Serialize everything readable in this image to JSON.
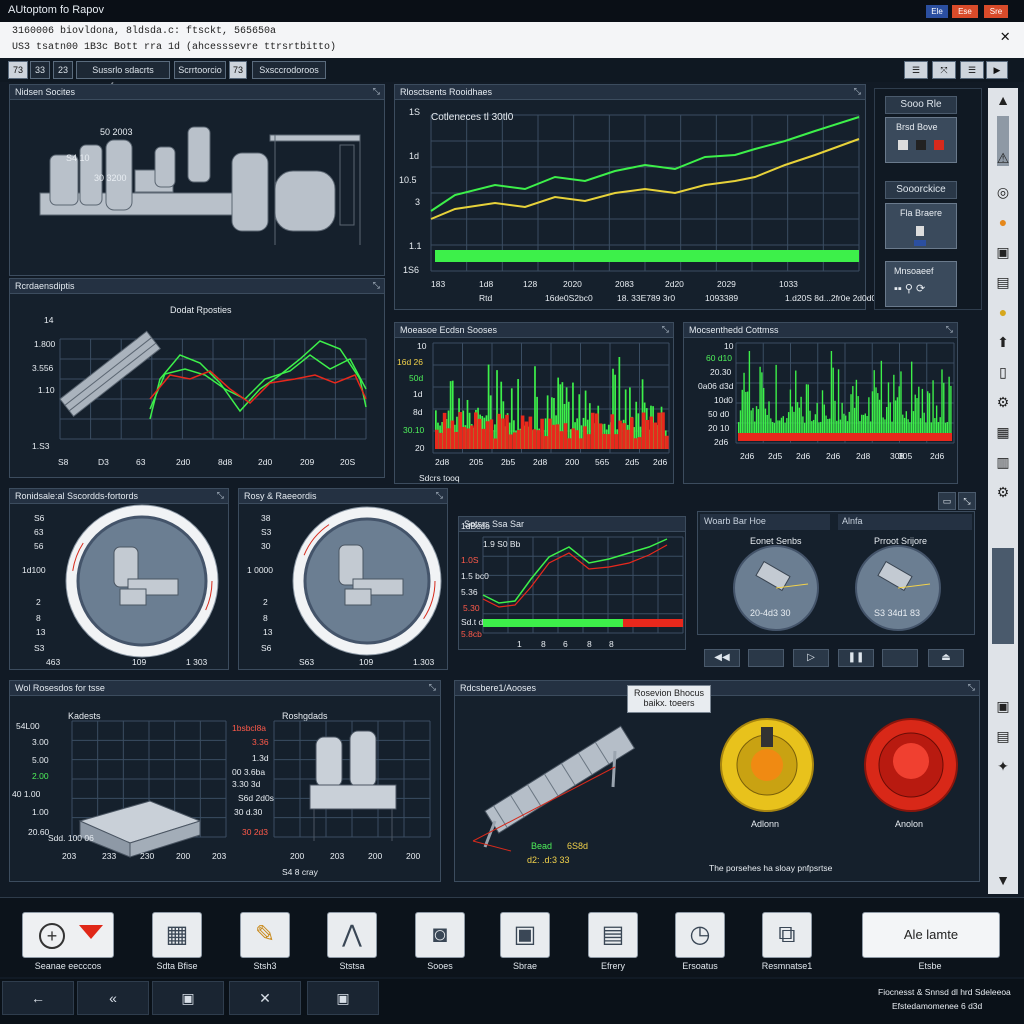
{
  "window": {
    "title": "AUtoptom fo Rapov",
    "btn1": "Ele",
    "btn2": "Ese",
    "btn3": "Sre"
  },
  "infobar": {
    "line1": "3160006 biovldona, 8ldsda.c: ftsckt, 565650a",
    "line2": "US3  tsatn00 1B3c   Bott rra   1d  (ahcesssevre  ttrsrtbitto)"
  },
  "toolbar": {
    "b1": "73",
    "b2": "33",
    "b3": "23",
    "b4": "Sussrlo sdacrts rferrocs",
    "b5": "Scrrtoorcio",
    "b6": "73",
    "b7": "Sxsccrodoroos"
  },
  "panels": {
    "machine_top": {
      "title": "Nidsen Socites",
      "labels": [
        "50 2003",
        "S4 10",
        "30 3200"
      ]
    },
    "trend_top": {
      "title": "Rlosctsents Rooidhaes",
      "series_label": "Cotleneces tl 30tl0",
      "ylabels": [
        "1S",
        "1d",
        "10.5",
        "3",
        "1.1",
        "1S6"
      ],
      "xlabels": [
        "183",
        "1d8",
        "128",
        "2020",
        "2083",
        "2d20",
        "2029",
        "1033"
      ],
      "xsub": [
        "Rtd",
        "16de0S2bc0",
        "18. 33E789 3r0",
        "1093389",
        "1.d20S 8d...2fr0e 2d0d0"
      ]
    },
    "conveyor_chart": {
      "title": "Rcrdaensdiptis",
      "subtitle": "Dodat Rposties",
      "ylabels": [
        "14",
        "1.800",
        "3.556",
        "1.10",
        "1.S3"
      ],
      "xlabels": [
        "S8",
        "D3",
        "63",
        "2d0",
        "8d8",
        "2d0",
        "209",
        "20S"
      ]
    },
    "bars_mid": {
      "title": "Moeasoe Ecdsn Sooses",
      "ylabels": [
        "10",
        "16d 26",
        "50d",
        "1d",
        "8d",
        "30.10",
        "20"
      ],
      "xlabels": [
        "2d8",
        "205",
        "2b5",
        "2d8",
        "200",
        "565",
        "2d5",
        "2d6"
      ],
      "foot": "Sdcrs tooq"
    },
    "bars_right": {
      "title": "Mocsenthedd Cottmss",
      "ylabels": [
        "10",
        "60 d10",
        "20.30",
        "0a06 d3d",
        "10d0",
        "50 d0",
        "20 10",
        "2d6"
      ],
      "xlabels": [
        "2d6",
        "2d5",
        "2d6",
        "2d6",
        "2d8",
        "308",
        "305",
        "2d6"
      ]
    },
    "gauge_left": {
      "title": "Ronidsale:al Sscordds-fortords",
      "ylabels": [
        "S6",
        "63",
        "56",
        "1d100",
        "2",
        "8",
        "13",
        "S3"
      ],
      "xlabels": [
        "463",
        "109",
        "1 303"
      ]
    },
    "gauge_right": {
      "title": "Rosy & Raeeordis",
      "ylabels": [
        "38",
        "S3",
        "30",
        "1 0000",
        "2",
        "8",
        "13",
        "S6"
      ],
      "xlabels": [
        "S63",
        "109",
        "1.303"
      ]
    },
    "mini_trend": {
      "title": "Sotsrs Ssa Sar",
      "ylabels": [
        "1dBcdo",
        "1.9 S0 Bb",
        "1.0S",
        "1.5 bc0",
        "5.36",
        "5.30",
        "Sd.t d",
        "5.8cb"
      ],
      "xlabels": [
        "1",
        "8",
        "6",
        "8",
        "8"
      ]
    },
    "sensors": {
      "title1": "Woarb Bar Hoe",
      "title2": "Alnfa",
      "sub1": "Eonet Senbs",
      "sub2": "Prroot Srijore",
      "val1": "20-4d3 30",
      "val2": "S3 34d1 83"
    },
    "inventory": {
      "title": "Wol Rosesdos for tsse",
      "sub1": "Kadests",
      "sub2": "Roshgdads",
      "ylabels": [
        "54L00",
        "3.00",
        "5.00",
        "2.00",
        "40 1.00",
        "1.00",
        "20.60"
      ],
      "xlabels": [
        "203",
        "233",
        "230",
        "200",
        "203",
        "200",
        "203",
        "200",
        "200"
      ],
      "mid_ylabels": [
        "1bsbcl8a",
        "3.36",
        "1.3d",
        "00 3.6ba",
        "3.30 3d",
        "S6d 2d0s",
        "30 d.30",
        "30 2d3"
      ],
      "foot": "Sdd. 100 06",
      "foot2": "S4 8 cray"
    },
    "control": {
      "title": "Rdcsbere1/Aooses",
      "tooltip1": "Rosevion Bhocus",
      "tooltip2": "baikx. toeers",
      "dim": "Bead",
      "dim_val": "6S8d",
      "dim2": "d2: .d:3 33",
      "knob1": "Adlonn",
      "knob2": "Anolon",
      "note": "The porsehes ha sloay pnfpsrtse"
    }
  },
  "rightcol": {
    "b1": "Sooo Rle",
    "b2": "Brsd Bove",
    "b3": "Sooorckice",
    "b4": "Fla Braere",
    "b5": "Mnsoaeef"
  },
  "dock": {
    "items": [
      "Seanae eecccos",
      "Sdta Bfise",
      "Stsh3",
      "Ststsa",
      "Sooes",
      "Sbrae",
      "Efrery",
      "Ersoatus",
      "Resmnatse1"
    ],
    "big_btn": "Ale lamte",
    "big_cap": "Etsbe"
  },
  "footer": {
    "line1": "Fiocnesst & Snnsd dl hrd Sdeleeoa",
    "line2": "Efstedamomenee 6 d3d"
  },
  "colors": {
    "green": "#3df04a",
    "yellow": "#e7d23a",
    "red": "#e8281c",
    "panel": "#15202c"
  }
}
